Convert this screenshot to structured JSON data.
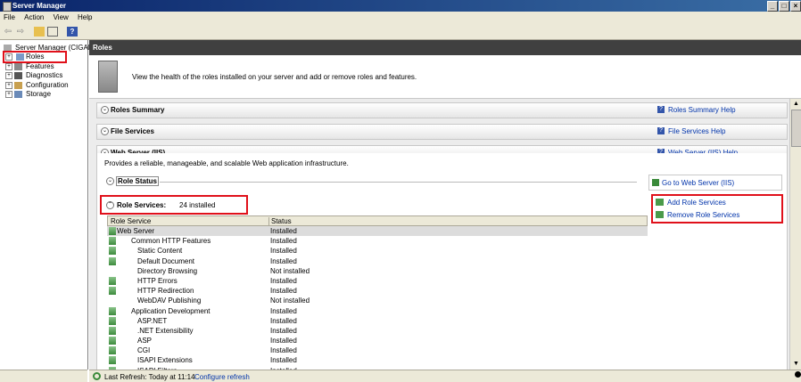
{
  "window": {
    "title": "Server Manager",
    "buttons": [
      "_",
      "□",
      "×"
    ]
  },
  "menu": [
    "File",
    "Action",
    "View",
    "Help"
  ],
  "toolbar": [
    "back-icon",
    "forward-icon",
    "up-folder-icon",
    "show-hide-tree-icon",
    "help-icon"
  ],
  "tree": {
    "root": "Server Manager (CIGAM-",
    "items": [
      {
        "label": "Roles",
        "icon": "roles-icon"
      },
      {
        "label": "Features",
        "icon": "features-icon"
      },
      {
        "label": "Diagnostics",
        "icon": "diagnostics-icon"
      },
      {
        "label": "Configuration",
        "icon": "configuration-icon"
      },
      {
        "label": "Storage",
        "icon": "storage-icon"
      }
    ]
  },
  "content": {
    "header": "Roles",
    "banner_text": "View the health of the roles installed on your server and add or remove roles and features.",
    "sections": [
      {
        "title": "Roles Summary",
        "help": "Roles Summary Help"
      },
      {
        "title": "File Services",
        "help": "File Services Help"
      },
      {
        "title": "Web Server (IIS)",
        "help": "Web Server (IIS) Help"
      }
    ],
    "iis": {
      "description": "Provides a reliable, manageable, and scalable Web application infrastructure.",
      "role_status": "Role Status",
      "goto": "Go to Web Server (IIS)",
      "role_services_label": "Role Services:",
      "role_services_count": "24 installed",
      "add": "Add Role Services",
      "remove": "Remove Role Services",
      "columns": [
        "Role Service",
        "Status"
      ],
      "rows": [
        {
          "name": "Web Server",
          "status": "Installed",
          "level": 0,
          "icon": true
        },
        {
          "name": "Common HTTP Features",
          "status": "Installed",
          "level": 1,
          "icon": true
        },
        {
          "name": "Static Content",
          "status": "Installed",
          "level": 2,
          "icon": true
        },
        {
          "name": "Default Document",
          "status": "Installed",
          "level": 2,
          "icon": true
        },
        {
          "name": "Directory Browsing",
          "status": "Not installed",
          "level": 2,
          "icon": false
        },
        {
          "name": "HTTP Errors",
          "status": "Installed",
          "level": 2,
          "icon": true
        },
        {
          "name": "HTTP Redirection",
          "status": "Installed",
          "level": 2,
          "icon": true
        },
        {
          "name": "WebDAV Publishing",
          "status": "Not installed",
          "level": 2,
          "icon": false
        },
        {
          "name": "Application Development",
          "status": "Installed",
          "level": 1,
          "icon": true
        },
        {
          "name": "ASP.NET",
          "status": "Installed",
          "level": 2,
          "icon": true
        },
        {
          "name": ".NET Extensibility",
          "status": "Installed",
          "level": 2,
          "icon": true
        },
        {
          "name": "ASP",
          "status": "Installed",
          "level": 2,
          "icon": true
        },
        {
          "name": "CGI",
          "status": "Installed",
          "level": 2,
          "icon": true
        },
        {
          "name": "ISAPI Extensions",
          "status": "Installed",
          "level": 2,
          "icon": true
        },
        {
          "name": "ISAPI Filters",
          "status": "Installed",
          "level": 2,
          "icon": true
        }
      ]
    }
  },
  "statusbar": {
    "last_refresh": "Last Refresh: Today at 11:14",
    "configure": "Configure refresh"
  }
}
